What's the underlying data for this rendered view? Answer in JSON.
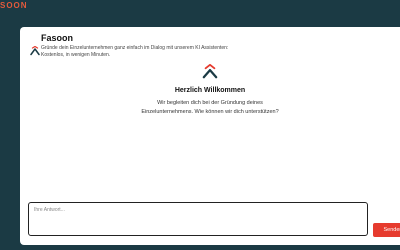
{
  "top_bar": {
    "brand": "SOON"
  },
  "header": {
    "brand_name": "Fasoon",
    "tagline": "Gründe dein Einzelunternehmen ganz einfach im Dialog mit unserem KI Assistenten: Kostenlos, in wenigen Minuten."
  },
  "welcome": {
    "title": "Herzlich Willkommen",
    "text": "Wir begleiten dich bei der Gründung deines Einzelunternehmens. Wie können wir dich unterstützen?"
  },
  "composer": {
    "placeholder": "Ihre Antwort...",
    "send_label": "Senden"
  },
  "colors": {
    "background": "#1b3a44",
    "accent": "#e63b2e",
    "logo_dark": "#1b3a44"
  }
}
